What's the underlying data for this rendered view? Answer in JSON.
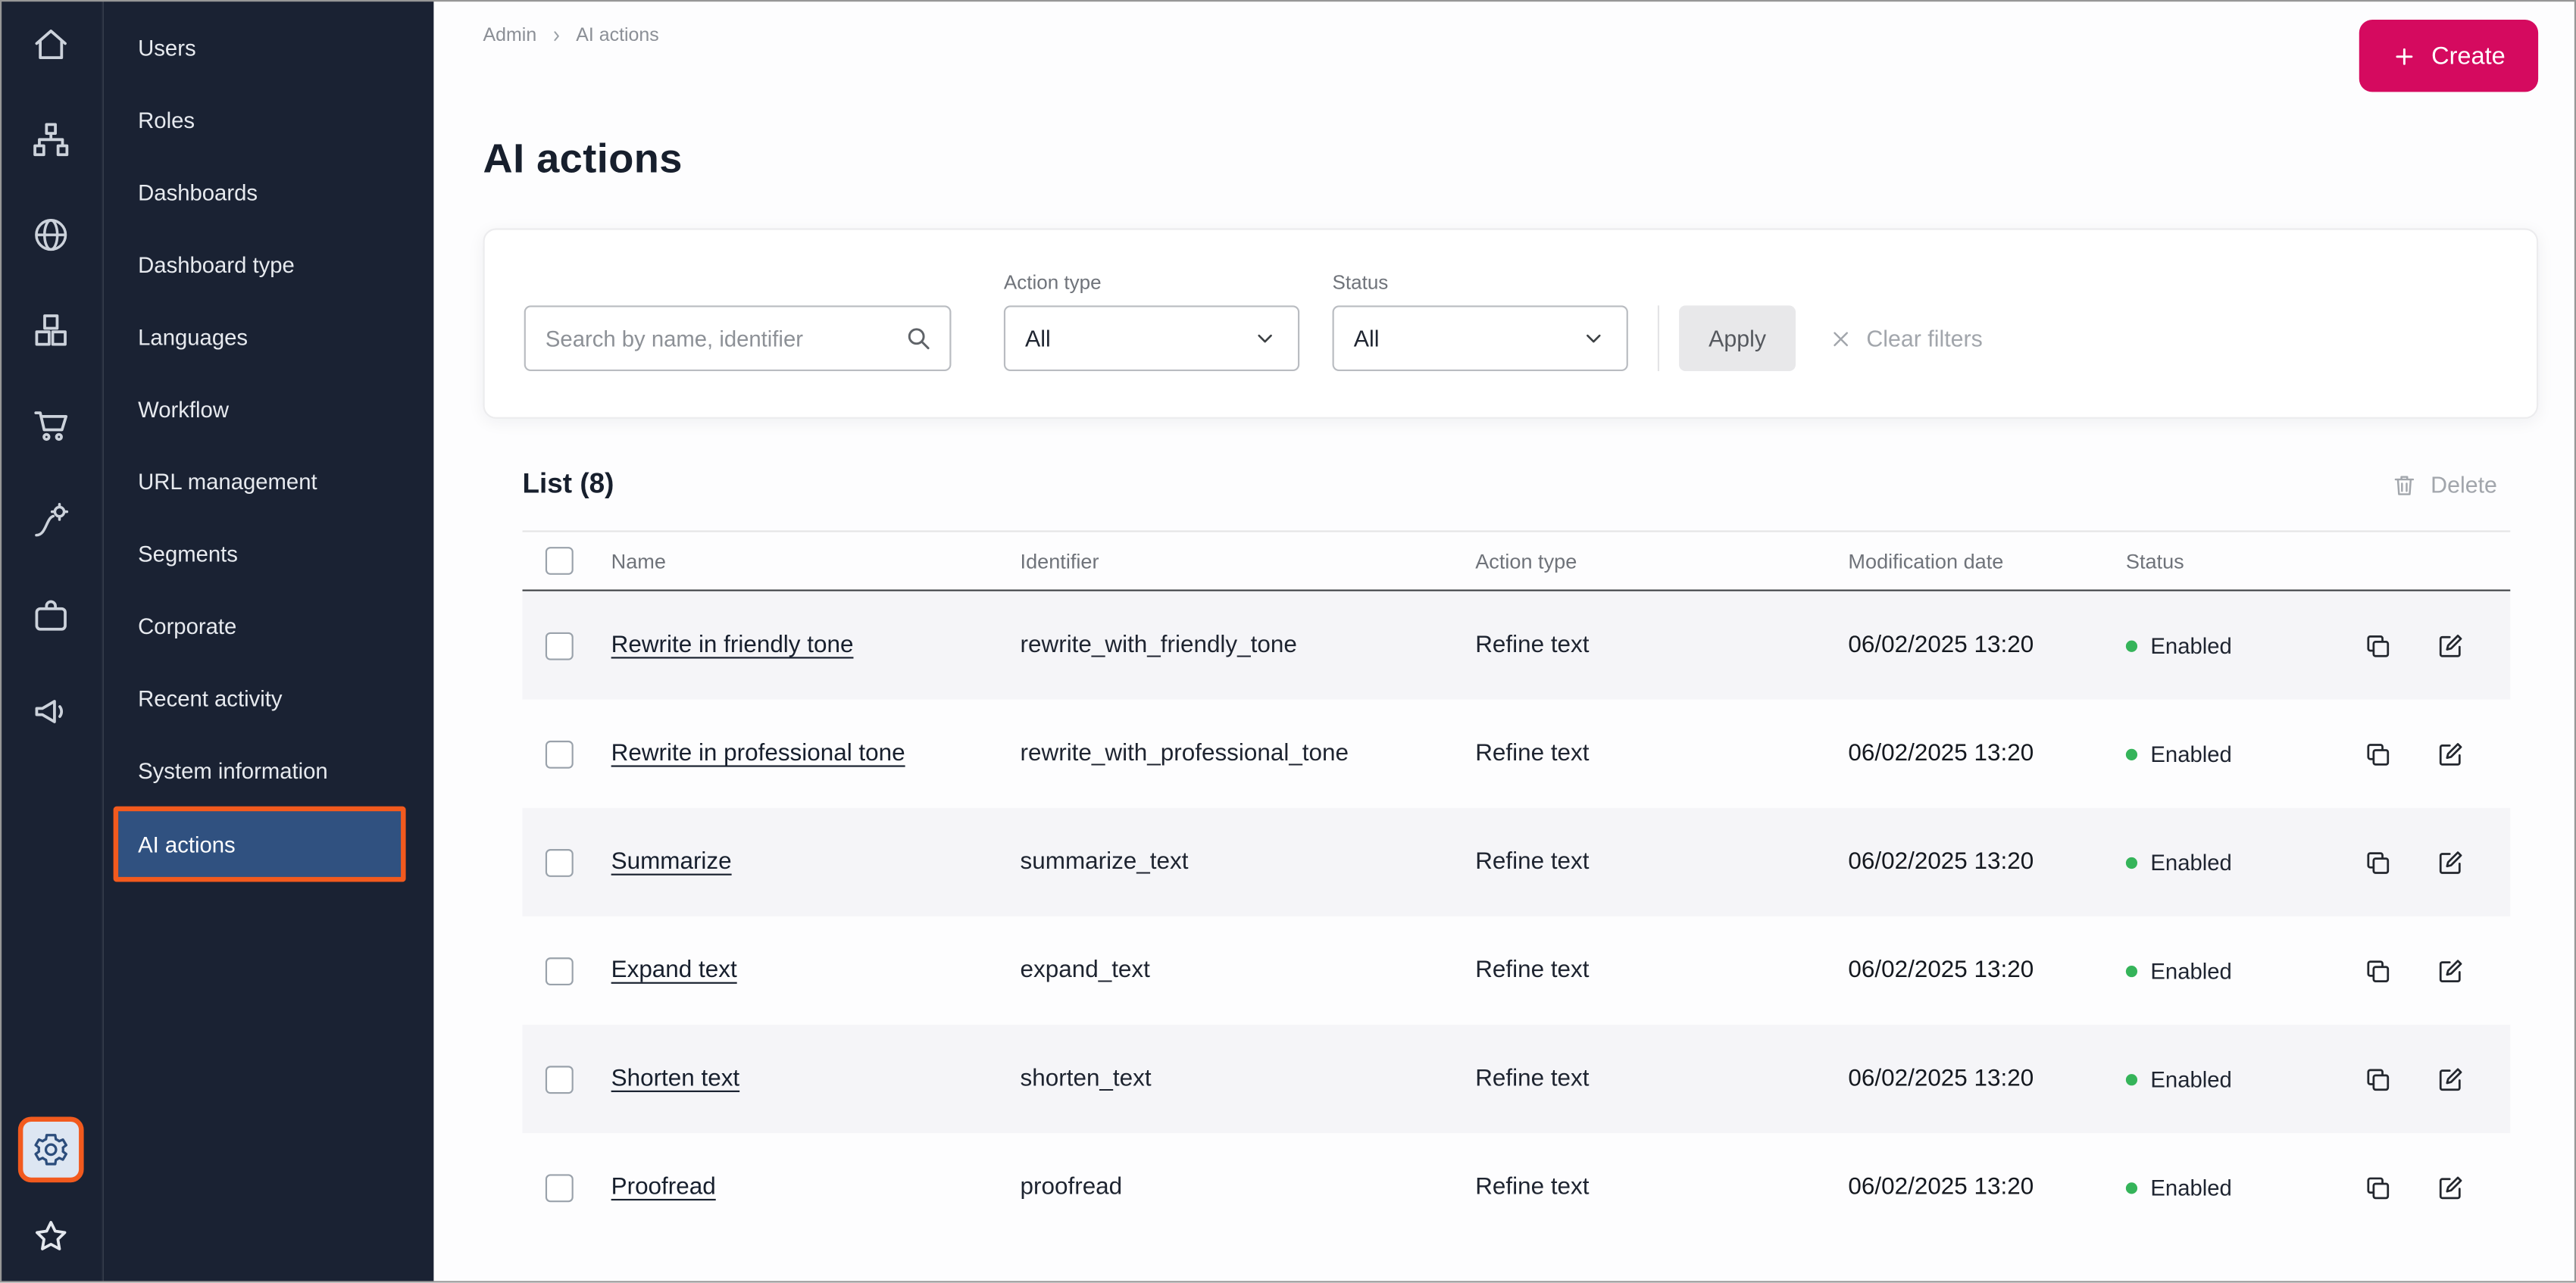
{
  "colors": {
    "sidebar_bg": "#1a2233",
    "active_item_bg": "#305180",
    "highlight_border": "#f25a1e",
    "create_button": "#d50a5f",
    "status_enabled": "#35b45a"
  },
  "rail": {
    "icons": [
      "home-icon",
      "hierarchy-icon",
      "globe-icon",
      "modules-icon",
      "cart-icon",
      "automation-icon",
      "briefcase-icon",
      "megaphone-icon"
    ],
    "bottom_icons": [
      "settings-gear-icon",
      "star-icon"
    ]
  },
  "sidebar": {
    "items": [
      "Users",
      "Roles",
      "Dashboards",
      "Dashboard type",
      "Languages",
      "Workflow",
      "URL management",
      "Segments",
      "Corporate",
      "Recent activity",
      "System information",
      "AI actions"
    ],
    "active_item": "AI actions"
  },
  "breadcrumb": {
    "items": [
      "Admin",
      "AI actions"
    ]
  },
  "header": {
    "title": "AI actions",
    "create_label": "Create"
  },
  "filters": {
    "search_placeholder": "Search by name, identifier",
    "action_type": {
      "label": "Action type",
      "value": "All"
    },
    "status": {
      "label": "Status",
      "value": "All"
    },
    "apply_label": "Apply",
    "clear_label": "Clear filters"
  },
  "list": {
    "title": "List (8)",
    "delete_label": "Delete",
    "columns": [
      "Name",
      "Identifier",
      "Action type",
      "Modification date",
      "Status"
    ],
    "rows": [
      {
        "name": "Rewrite in friendly tone",
        "identifier": "rewrite_with_friendly_tone",
        "action_type": "Refine text",
        "modification_date": "06/02/2025 13:20",
        "status": "Enabled"
      },
      {
        "name": "Rewrite in professional tone",
        "identifier": "rewrite_with_professional_tone",
        "action_type": "Refine text",
        "modification_date": "06/02/2025 13:20",
        "status": "Enabled"
      },
      {
        "name": "Summarize",
        "identifier": "summarize_text",
        "action_type": "Refine text",
        "modification_date": "06/02/2025 13:20",
        "status": "Enabled"
      },
      {
        "name": "Expand text",
        "identifier": "expand_text",
        "action_type": "Refine text",
        "modification_date": "06/02/2025 13:20",
        "status": "Enabled"
      },
      {
        "name": "Shorten text",
        "identifier": "shorten_text",
        "action_type": "Refine text",
        "modification_date": "06/02/2025 13:20",
        "status": "Enabled"
      },
      {
        "name": "Proofread",
        "identifier": "proofread",
        "action_type": "Refine text",
        "modification_date": "06/02/2025 13:20",
        "status": "Enabled"
      }
    ]
  }
}
